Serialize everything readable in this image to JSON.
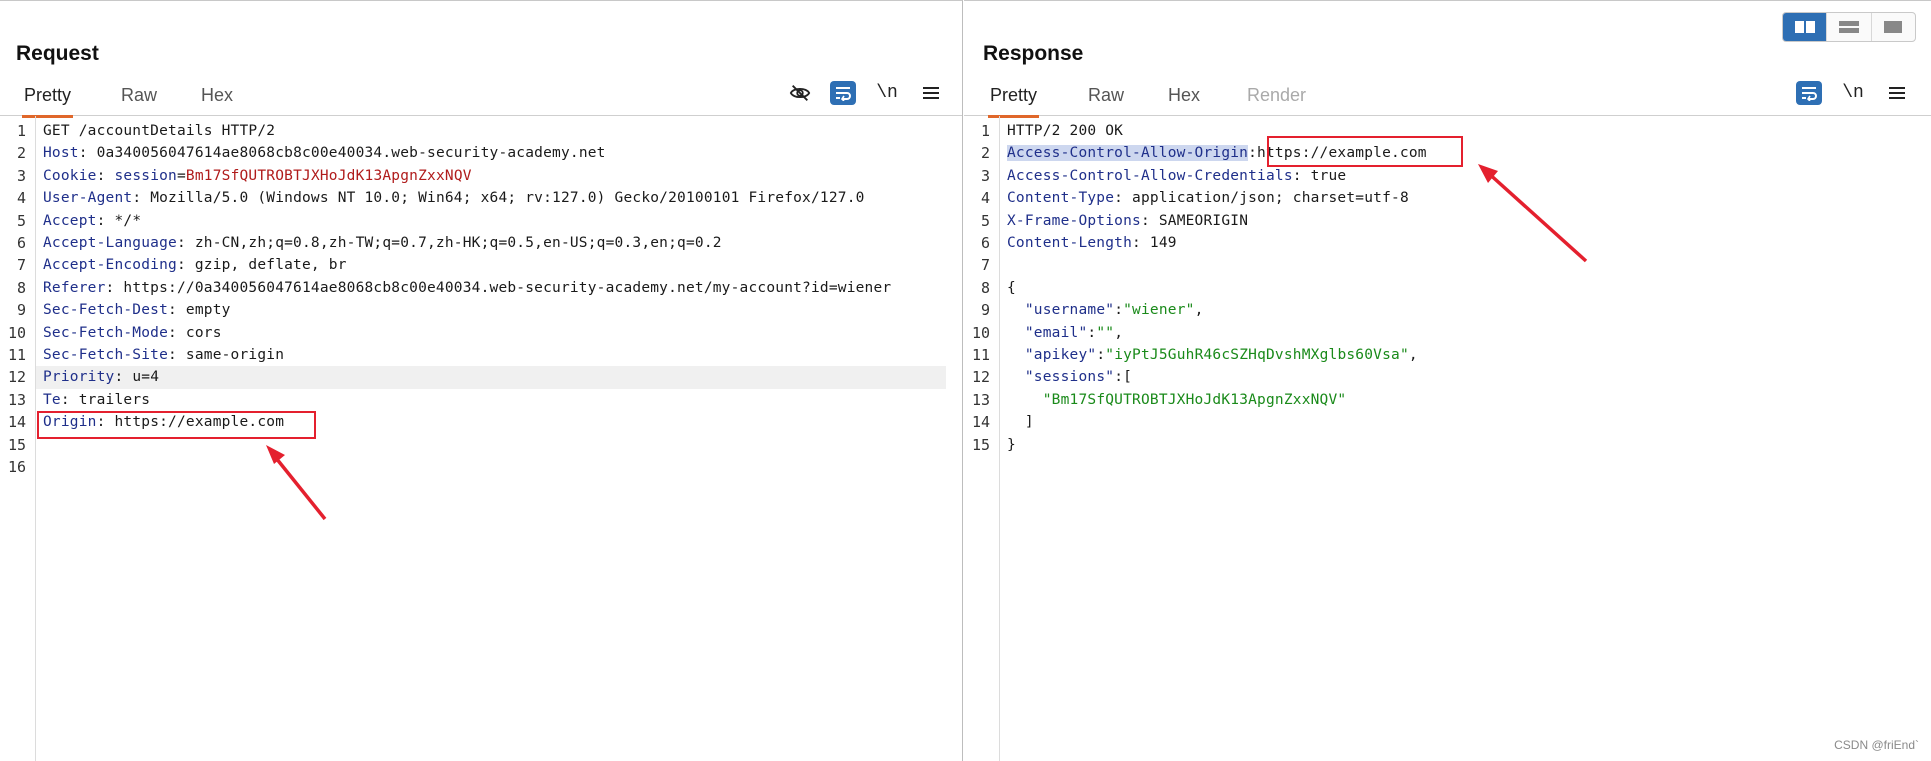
{
  "request": {
    "title": "Request",
    "tabs": [
      "Pretty",
      "Raw",
      "Hex"
    ],
    "active_tab": "Pretty",
    "newline_toggle": "\\n",
    "line_numbers": [
      "1",
      "2",
      "3",
      "4",
      "5",
      "6",
      "7",
      "8",
      "9",
      "10",
      "11",
      "12",
      "13",
      "14",
      "15",
      "16"
    ],
    "lines": [
      {
        "key": "",
        "sep": "",
        "value": "GET /accountDetails HTTP/2"
      },
      {
        "key": "Host",
        "sep": ": ",
        "value": "0a340056047614ae8068cb8c00e40034.web-security-academy.net"
      },
      {
        "key": "Cookie",
        "sep": ": ",
        "cookie_name": "session",
        "cookie_eq": "=",
        "value": "Bm17SfQUTROBTJXHoJdK13ApgnZxxNQV"
      },
      {
        "key": "User-Agent",
        "sep": ": ",
        "value": "Mozilla/5.0 (Windows NT 10.0; Win64; x64; rv:127.0) Gecko/20100101 Firefox/127.0"
      },
      {
        "key": "Accept",
        "sep": ": ",
        "value": "*/*"
      },
      {
        "key": "Accept-Language",
        "sep": ": ",
        "value": "zh-CN,zh;q=0.8,zh-TW;q=0.7,zh-HK;q=0.5,en-US;q=0.3,en;q=0.2"
      },
      {
        "key": "Accept-Encoding",
        "sep": ": ",
        "value": "gzip, deflate, br"
      },
      {
        "key": "Referer",
        "sep": ": ",
        "value": "https://0a340056047614ae8068cb8c00e40034.web-security-academy.net/my-account?id=wiener"
      },
      {
        "key": "Sec-Fetch-Dest",
        "sep": ": ",
        "value": "empty"
      },
      {
        "key": "Sec-Fetch-Mode",
        "sep": ": ",
        "value": "cors"
      },
      {
        "key": "Sec-Fetch-Site",
        "sep": ": ",
        "value": "same-origin"
      },
      {
        "key": "Priority",
        "sep": ": ",
        "value": "u=4"
      },
      {
        "key": "Te",
        "sep": ": ",
        "value": "trailers"
      },
      {
        "key": "Origin",
        "sep": ": ",
        "value": "https://example.com"
      },
      {
        "key": "",
        "sep": "",
        "value": ""
      },
      {
        "key": "",
        "sep": "",
        "value": ""
      }
    ]
  },
  "response": {
    "title": "Response",
    "tabs": [
      "Pretty",
      "Raw",
      "Hex",
      "Render"
    ],
    "active_tab": "Pretty",
    "newline_toggle": "\\n",
    "line_numbers": [
      "1",
      "2",
      "3",
      "4",
      "5",
      "6",
      "7",
      "8",
      "9",
      "10",
      "11",
      "12",
      "13",
      "14",
      "15"
    ],
    "headers": [
      {
        "key": "",
        "sep": "",
        "value": "HTTP/2 200 OK"
      },
      {
        "key": "Access-Control-Allow-Origin",
        "sep": ":",
        "value": "https://example.com"
      },
      {
        "key": "Access-Control-Allow-Credentials",
        "sep": ": ",
        "value": "true"
      },
      {
        "key": "Content-Type",
        "sep": ": ",
        "value": "application/json; charset=utf-8"
      },
      {
        "key": "X-Frame-Options",
        "sep": ": ",
        "value": "SAMEORIGIN"
      },
      {
        "key": "Content-Length",
        "sep": ": ",
        "value": "149"
      }
    ],
    "body": {
      "open": "{",
      "username_key": "\"username\"",
      "username_val": "\"wiener\"",
      "email_key": "\"email\"",
      "email_val": "\"\"",
      "apikey_key": "\"apikey\"",
      "apikey_val": "\"iyPtJ5GuhR46cSZHqDvshMXglbs60Vsa\"",
      "sessions_key": "\"sessions\"",
      "sessions_open": "[",
      "session_val": "\"Bm17SfQUTROBTJXHoJdK13ApgnZxxNQV\"",
      "sessions_close": "]",
      "close": "}"
    }
  },
  "watermark": "CSDN @friEnd`",
  "colors": {
    "accent": "#e0672a",
    "toggle_blue": "#2e6fb4",
    "annotation_red": "#e4202e"
  }
}
